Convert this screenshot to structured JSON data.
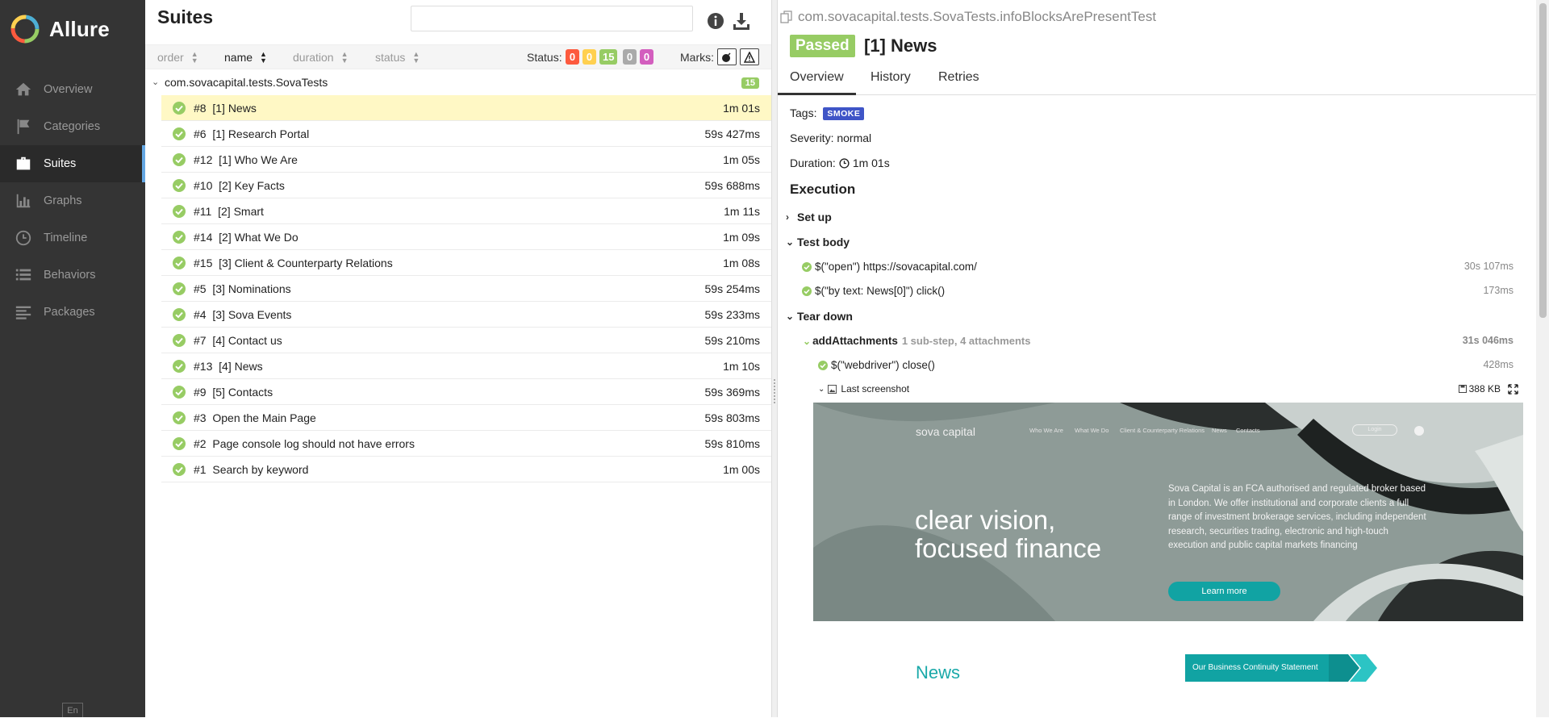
{
  "app": {
    "name": "Allure"
  },
  "sidebar": {
    "items": [
      {
        "label": "Overview",
        "icon": "home-icon"
      },
      {
        "label": "Categories",
        "icon": "flag-icon"
      },
      {
        "label": "Suites",
        "icon": "briefcase-icon",
        "active": true
      },
      {
        "label": "Graphs",
        "icon": "bar-chart-icon"
      },
      {
        "label": "Timeline",
        "icon": "clock-icon"
      },
      {
        "label": "Behaviors",
        "icon": "list-icon"
      },
      {
        "label": "Packages",
        "icon": "align-left-icon"
      }
    ],
    "lang": "En"
  },
  "suites": {
    "title": "Suites",
    "search_placeholder": "",
    "sort": {
      "order": "order",
      "name": "name",
      "duration": "duration",
      "status": "status"
    },
    "status_label": "Status:",
    "status_counts": [
      {
        "value": "0",
        "color": "#fd5a3e"
      },
      {
        "value": "0",
        "color": "#ffd050"
      },
      {
        "value": "15",
        "color": "#97cc64"
      },
      {
        "value": "0",
        "color": "#aaaaaa"
      },
      {
        "value": "0",
        "color": "#d35ebe"
      }
    ],
    "marks_label": "Marks:",
    "group": {
      "name": "com.sovacapital.tests.SovaTests",
      "count": "15"
    },
    "tests": [
      {
        "num": "#8",
        "name": "[1] News",
        "duration": "1m 01s",
        "selected": true
      },
      {
        "num": "#6",
        "name": "[1] Research Portal",
        "duration": "59s 427ms"
      },
      {
        "num": "#12",
        "name": "[1] Who We Are",
        "duration": "1m 05s"
      },
      {
        "num": "#10",
        "name": "[2] Key Facts",
        "duration": "59s 688ms"
      },
      {
        "num": "#11",
        "name": "[2] Smart",
        "duration": "1m 11s"
      },
      {
        "num": "#14",
        "name": "[2] What We Do",
        "duration": "1m 09s"
      },
      {
        "num": "#15",
        "name": "[3] Client & Counterparty Relations",
        "duration": "1m 08s"
      },
      {
        "num": "#5",
        "name": "[3] Nominations",
        "duration": "59s 254ms"
      },
      {
        "num": "#4",
        "name": "[3] Sova Events",
        "duration": "59s 233ms"
      },
      {
        "num": "#7",
        "name": "[4] Contact us",
        "duration": "59s 210ms"
      },
      {
        "num": "#13",
        "name": "[4] News",
        "duration": "1m 10s"
      },
      {
        "num": "#9",
        "name": "[5] Contacts",
        "duration": "59s 369ms"
      },
      {
        "num": "#3",
        "name": "Open the Main Page",
        "duration": "59s 803ms"
      },
      {
        "num": "#2",
        "name": "Page console log should not have errors",
        "duration": "59s 810ms"
      },
      {
        "num": "#1",
        "name": "Search by keyword",
        "duration": "1m 00s"
      }
    ]
  },
  "detail": {
    "fqn": "com.sovacapital.tests.SovaTests.infoBlocksArePresentTest",
    "status": "Passed",
    "title": "[1] News",
    "tabs": [
      "Overview",
      "History",
      "Retries"
    ],
    "tags_label": "Tags:",
    "tag": "SMOKE",
    "severity": "Severity: normal",
    "duration_label": "Duration:",
    "duration": "1m 01s",
    "execution_title": "Execution",
    "setup_label": "Set up",
    "body_label": "Test body",
    "steps": [
      {
        "text": "$(\"open\") https://sovacapital.com/",
        "duration": "30s 107ms"
      },
      {
        "text": "$(\"by text: News[0]\") click()",
        "duration": "173ms"
      }
    ],
    "teardown_label": "Tear down",
    "add_attachments": {
      "name": "addAttachments",
      "note": "1 sub-step, 4 attachments",
      "duration": "31s 046ms"
    },
    "close_step": {
      "text": "$(\"webdriver\") close()",
      "duration": "428ms"
    },
    "screenshot": {
      "label": "Last screenshot",
      "size": "388 KB"
    }
  },
  "site": {
    "logo": "sova capital",
    "nav": [
      "Who We Are",
      "What We Do",
      "Client & Counterparty Relations",
      "News",
      "Contacts"
    ],
    "login": "Login",
    "headline_1": "clear vision,",
    "headline_2": "focused finance",
    "text": "Sova Capital is an FCA authorised and regulated broker based in London. We offer institutional and corporate clients a full range of investment brokerage services, including independent research, securities trading, electronic and high-touch execution and public capital markets financing",
    "learn_more": "Learn more",
    "news": "News",
    "bcs": "Our Business Continuity Statement"
  }
}
